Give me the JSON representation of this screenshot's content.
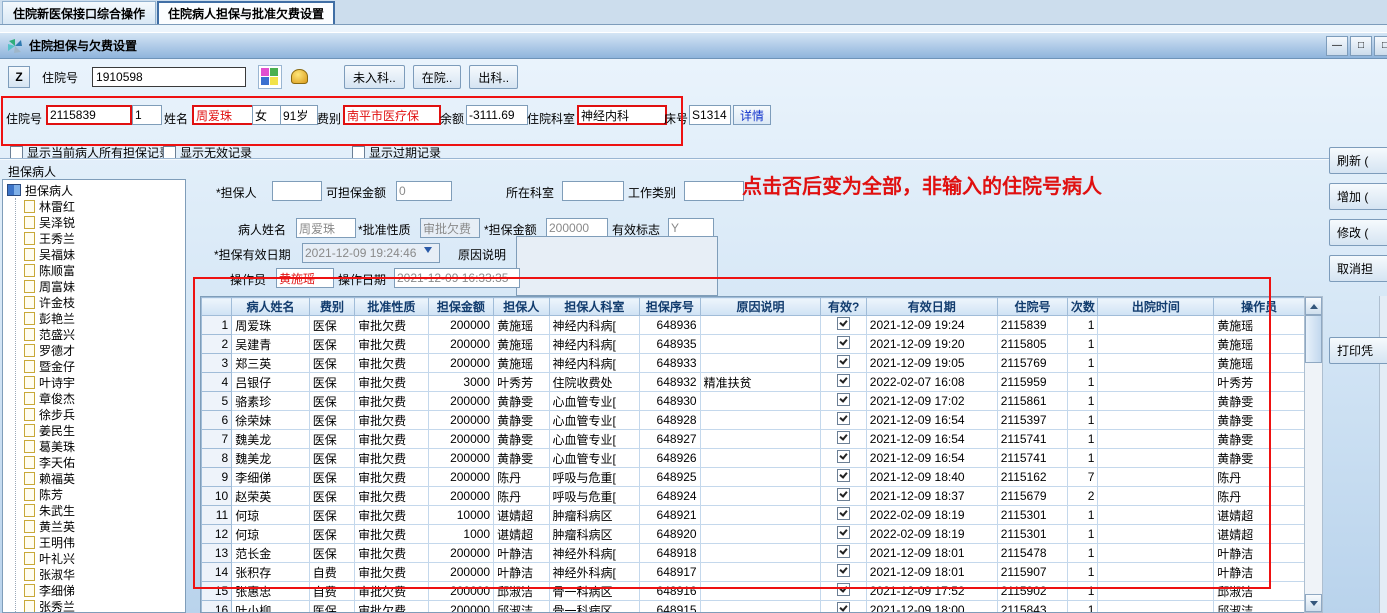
{
  "colors": {
    "highlight_red": "#ee1111",
    "annotation_red": "#ee2222",
    "header_text_blue": "#123c6e"
  },
  "tabs": {
    "items": [
      {
        "label": "住院新医保接口综合操作",
        "active": false
      },
      {
        "label": "住院病人担保与批准欠费设置",
        "active": true
      }
    ]
  },
  "window": {
    "title": "住院担保与欠费设置",
    "icon": "pinwheel-icon",
    "controls": {
      "minimize": "—",
      "maximize": "□",
      "close": "□"
    }
  },
  "toolbar": {
    "z_button": "Z",
    "admission_label": "住院号",
    "admission_value": "1910598",
    "icons": [
      "table-icon",
      "bell-icon"
    ],
    "buttons": [
      {
        "label": "未入科.."
      },
      {
        "label": "在院.."
      },
      {
        "label": "出科.."
      }
    ]
  },
  "patient_bar": {
    "admission_label": "住院号",
    "admission_no": "2115839",
    "sub_no": "1",
    "name_label": "姓名",
    "name": "周爱珠",
    "gender": "女",
    "age": "91岁",
    "fee_type_label": "费别",
    "fee_type": "南平市医疗保",
    "balance_label": "余额",
    "balance": "-3111.69",
    "dept_label": "住院科室",
    "dept": "神经内科",
    "bed_label": "床号",
    "bed": "S1314",
    "detail_button": "详情"
  },
  "filters": {
    "items": [
      {
        "label": "显示当前病人所有担保记录",
        "checked": false
      },
      {
        "label": "显示无效记录",
        "checked": false
      },
      {
        "label": "显示过期记录",
        "checked": false
      }
    ]
  },
  "tree": {
    "header": "担保病人",
    "root": "担保病人",
    "items": [
      "林雷红",
      "吴泽锐",
      "王秀兰",
      "吴福妹",
      "陈顺富",
      "周富妹",
      "许金枝",
      "彭艳兰",
      "范盛兴",
      "罗德才",
      "暨金仔",
      "叶诗宇",
      "章俊杰",
      "徐步兵",
      "姜民生",
      "葛美珠",
      "李天佑",
      "赖福英",
      "陈芳",
      "朱武生",
      "黄兰英",
      "王明伟",
      "叶礼兴",
      "张淑华",
      "李细俤",
      "张秀兰"
    ]
  },
  "form": {
    "guarantor_label": "*担保人",
    "guarantor_value": "",
    "limit_label": "可担保金额",
    "limit_value": "0",
    "dept_label": "所在科室",
    "dept_value": "",
    "job_label": "工作类别",
    "job_value": "",
    "patient_label": "病人姓名",
    "patient_value": "周爱珠",
    "nature_label": "*批准性质",
    "nature_value": "审批欠费",
    "amount_label": "*担保金额",
    "amount_value": "200000",
    "valid_flag_label": "有效标志",
    "valid_flag_value": "Y",
    "valid_date_label": "*担保有效日期",
    "valid_date_value": "2021-12-09 19:24:46",
    "reason_label": "原因说明",
    "reason_value": "",
    "operator_label": "操作员",
    "operator_value": "黄施瑶",
    "op_date_label": "操作日期",
    "op_date_value": "2021-12-09 16:33:35"
  },
  "annotation": {
    "text": "点击否后变为全部，非输入的住院号病人"
  },
  "table": {
    "columns": [
      "病人姓名",
      "费别",
      "批准性质",
      "担保金额",
      "担保人",
      "担保人科室",
      "担保序号",
      "原因说明",
      "有效?",
      "有效日期",
      "住院号",
      "次数",
      "出院时间",
      "操作员"
    ],
    "rows": [
      {
        "no": "1",
        "name": "周爱珠",
        "fee": "医保",
        "nature": "审批欠费",
        "amount": "200000",
        "guarantor": "黄施瑶",
        "dept": "神经内科病[",
        "seq": "648936",
        "reason": "",
        "valid": true,
        "valid_date": "2021-12-09 19:24",
        "admission": "2115839",
        "times": "1",
        "discharge": "",
        "operator": "黄施瑶"
      },
      {
        "no": "2",
        "name": "吴建青",
        "fee": "医保",
        "nature": "审批欠费",
        "amount": "200000",
        "guarantor": "黄施瑶",
        "dept": "神经内科病[",
        "seq": "648935",
        "reason": "",
        "valid": true,
        "valid_date": "2021-12-09 19:20",
        "admission": "2115805",
        "times": "1",
        "discharge": "",
        "operator": "黄施瑶"
      },
      {
        "no": "3",
        "name": "郑三英",
        "fee": "医保",
        "nature": "审批欠费",
        "amount": "200000",
        "guarantor": "黄施瑶",
        "dept": "神经内科病[",
        "seq": "648933",
        "reason": "",
        "valid": true,
        "valid_date": "2021-12-09 19:05",
        "admission": "2115769",
        "times": "1",
        "discharge": "",
        "operator": "黄施瑶"
      },
      {
        "no": "4",
        "name": "吕银仔",
        "fee": "医保",
        "nature": "审批欠费",
        "amount": "3000",
        "guarantor": "叶秀芳",
        "dept": "住院收费处",
        "seq": "648932",
        "reason": "精准扶贫",
        "valid": true,
        "valid_date": "2022-02-07 16:08",
        "admission": "2115959",
        "times": "1",
        "discharge": "",
        "operator": "叶秀芳"
      },
      {
        "no": "5",
        "name": "骆素珍",
        "fee": "医保",
        "nature": "审批欠费",
        "amount": "200000",
        "guarantor": "黄静雯",
        "dept": "心血管专业[",
        "seq": "648930",
        "reason": "",
        "valid": true,
        "valid_date": "2021-12-09 17:02",
        "admission": "2115861",
        "times": "1",
        "discharge": "",
        "operator": "黄静雯"
      },
      {
        "no": "6",
        "name": "徐荣妹",
        "fee": "医保",
        "nature": "审批欠费",
        "amount": "200000",
        "guarantor": "黄静雯",
        "dept": "心血管专业[",
        "seq": "648928",
        "reason": "",
        "valid": true,
        "valid_date": "2021-12-09 16:54",
        "admission": "2115397",
        "times": "1",
        "discharge": "",
        "operator": "黄静雯"
      },
      {
        "no": "7",
        "name": "魏美龙",
        "fee": "医保",
        "nature": "审批欠费",
        "amount": "200000",
        "guarantor": "黄静雯",
        "dept": "心血管专业[",
        "seq": "648927",
        "reason": "",
        "valid": true,
        "valid_date": "2021-12-09 16:54",
        "admission": "2115741",
        "times": "1",
        "discharge": "",
        "operator": "黄静雯"
      },
      {
        "no": "8",
        "name": "魏美龙",
        "fee": "医保",
        "nature": "审批欠费",
        "amount": "200000",
        "guarantor": "黄静雯",
        "dept": "心血管专业[",
        "seq": "648926",
        "reason": "",
        "valid": true,
        "valid_date": "2021-12-09 16:54",
        "admission": "2115741",
        "times": "1",
        "discharge": "",
        "operator": "黄静雯"
      },
      {
        "no": "9",
        "name": "李细俤",
        "fee": "医保",
        "nature": "审批欠费",
        "amount": "200000",
        "guarantor": "陈丹",
        "dept": "呼吸与危重[",
        "seq": "648925",
        "reason": "",
        "valid": true,
        "valid_date": "2021-12-09 18:40",
        "admission": "2115162",
        "times": "7",
        "discharge": "",
        "operator": "陈丹"
      },
      {
        "no": "10",
        "name": "赵荣英",
        "fee": "医保",
        "nature": "审批欠费",
        "amount": "200000",
        "guarantor": "陈丹",
        "dept": "呼吸与危重[",
        "seq": "648924",
        "reason": "",
        "valid": true,
        "valid_date": "2021-12-09 18:37",
        "admission": "2115679",
        "times": "2",
        "discharge": "",
        "operator": "陈丹"
      },
      {
        "no": "11",
        "name": "何琼",
        "fee": "医保",
        "nature": "审批欠费",
        "amount": "10000",
        "guarantor": "谌婧超",
        "dept": "肿瘤科病区",
        "seq": "648921",
        "reason": "",
        "valid": true,
        "valid_date": "2022-02-09 18:19",
        "admission": "2115301",
        "times": "1",
        "discharge": "",
        "operator": "谌婧超"
      },
      {
        "no": "12",
        "name": "何琼",
        "fee": "医保",
        "nature": "审批欠费",
        "amount": "1000",
        "guarantor": "谌婧超",
        "dept": "肿瘤科病区",
        "seq": "648920",
        "reason": "",
        "valid": true,
        "valid_date": "2022-02-09 18:19",
        "admission": "2115301",
        "times": "1",
        "discharge": "",
        "operator": "谌婧超"
      },
      {
        "no": "13",
        "name": "范长金",
        "fee": "医保",
        "nature": "审批欠费",
        "amount": "200000",
        "guarantor": "叶静洁",
        "dept": "神经外科病[",
        "seq": "648918",
        "reason": "",
        "valid": true,
        "valid_date": "2021-12-09 18:01",
        "admission": "2115478",
        "times": "1",
        "discharge": "",
        "operator": "叶静洁"
      },
      {
        "no": "14",
        "name": "张积存",
        "fee": "自费",
        "nature": "审批欠费",
        "amount": "200000",
        "guarantor": "叶静洁",
        "dept": "神经外科病[",
        "seq": "648917",
        "reason": "",
        "valid": true,
        "valid_date": "2021-12-09 18:01",
        "admission": "2115907",
        "times": "1",
        "discharge": "",
        "operator": "叶静洁"
      },
      {
        "no": "15",
        "name": "张惠忠",
        "fee": "自费",
        "nature": "审批欠费",
        "amount": "200000",
        "guarantor": "邱淑洁",
        "dept": "骨一科病区",
        "seq": "648916",
        "reason": "",
        "valid": true,
        "valid_date": "2021-12-09 17:52",
        "admission": "2115902",
        "times": "1",
        "discharge": "",
        "operator": "邱淑洁"
      },
      {
        "no": "16",
        "name": "叶小柳",
        "fee": "医保",
        "nature": "审批欠费",
        "amount": "200000",
        "guarantor": "邱淑洁",
        "dept": "骨一科病区",
        "seq": "648915",
        "reason": "",
        "valid": true,
        "valid_date": "2021-12-09 18:00",
        "admission": "2115843",
        "times": "1",
        "discharge": "",
        "operator": "邱淑洁"
      }
    ]
  },
  "side_buttons": {
    "items": [
      {
        "label": "刷新 (",
        "name": "refresh-button"
      },
      {
        "label": "增加 (",
        "name": "add-button"
      },
      {
        "label": "修改 (",
        "name": "modify-button"
      },
      {
        "label": "取消担",
        "name": "cancel-guarantee-button"
      },
      {
        "label": "打印凭",
        "name": "print-voucher-button"
      }
    ]
  }
}
